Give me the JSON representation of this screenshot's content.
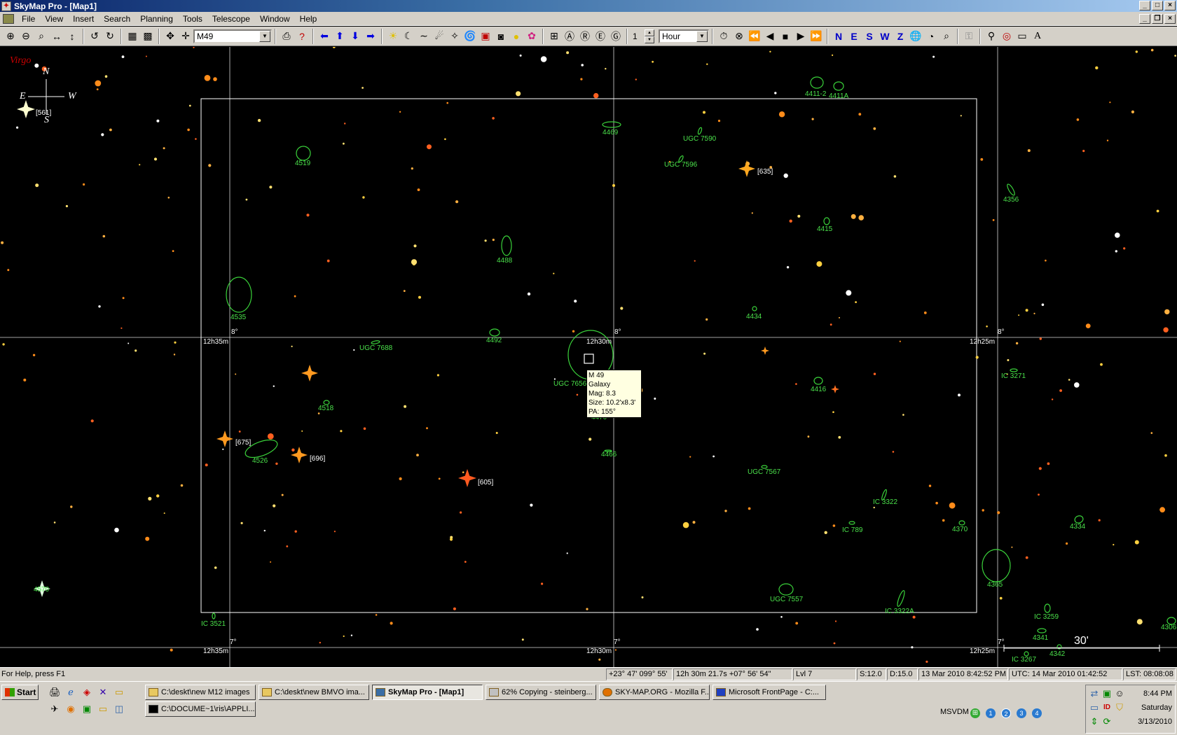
{
  "window": {
    "title": "SkyMap Pro - [Map1]"
  },
  "menu": [
    "File",
    "View",
    "Insert",
    "Search",
    "Planning",
    "Tools",
    "Telescope",
    "Window",
    "Help"
  ],
  "toolbar": {
    "object_search": "M49",
    "step_value": "1",
    "step_unit": "Hour",
    "compass_buttons": [
      "N",
      "E",
      "S",
      "W",
      "Z"
    ]
  },
  "map": {
    "constellation": "Virgo",
    "compass": {
      "n": "N",
      "e": "E",
      "s": "S",
      "w": "W"
    },
    "grid_labels": {
      "ra_top": [
        "12h35m",
        "12h30m",
        "12h25m"
      ],
      "ra_bottom": [
        "12h35m",
        "12h30m",
        "12h25m"
      ],
      "dec_mid": [
        "8°",
        "8°",
        "8°"
      ],
      "dec_bottom": [
        "7°",
        "7°",
        "7°"
      ]
    },
    "star_labels": [
      "[561]",
      "[635]",
      "[675]",
      "[696]",
      "[605]"
    ],
    "objects": [
      "4411-2",
      "4411A",
      "4469",
      "UGC 7590",
      "UGC 7596",
      "4519",
      "4356",
      "4415",
      "4488",
      "4535",
      "4434",
      "4492",
      "UGC 7688",
      "UGC 7656",
      "4470",
      "4416",
      "IC 3271",
      "4518",
      "4526",
      "4466",
      "UGC 7567",
      "IC 3322",
      "IC 789",
      "4370",
      "4334",
      "4570",
      "4365",
      "UGC 7557",
      "IC 3322A",
      "IC 3521",
      "IC 3259",
      "4341",
      "4342",
      "IC 3267",
      "4306"
    ],
    "tooltip": [
      "M 49",
      "Galaxy",
      "Mag: 8.3",
      "Size: 10.2'x8.3'",
      "PA: 155°"
    ],
    "scale_label": "30'"
  },
  "status": {
    "help": "For Help, press F1",
    "cells": [
      "+23° 47'  099° 55'",
      "12h 30m 21.7s  +07° 56' 54\"",
      "Lvl 7",
      "S:12.0",
      "D:15.0",
      "13 Mar 2010 8:42:52 PM",
      "UTC: 14 Mar 2010 01:42:52",
      "LST: 08:08:08"
    ]
  },
  "taskbar": {
    "start": "Start",
    "tasks": [
      "C:\\deskt\\new M12 images",
      "C:\\deskt\\new BMVO ima...",
      "SkyMap Pro - [Map1]",
      "62% Copying - steinberg...",
      "SKY-MAP.ORG - Mozilla F...",
      "Microsoft FrontPage - C:...",
      "C:\\DOCUME~1\\ris\\APPLI..."
    ],
    "tray_label": "MSVDM",
    "desktops": [
      "1",
      "2",
      "3",
      "4"
    ],
    "clock": {
      "time": "8:44 PM",
      "day": "Saturday",
      "date": "3/13/2010"
    }
  }
}
